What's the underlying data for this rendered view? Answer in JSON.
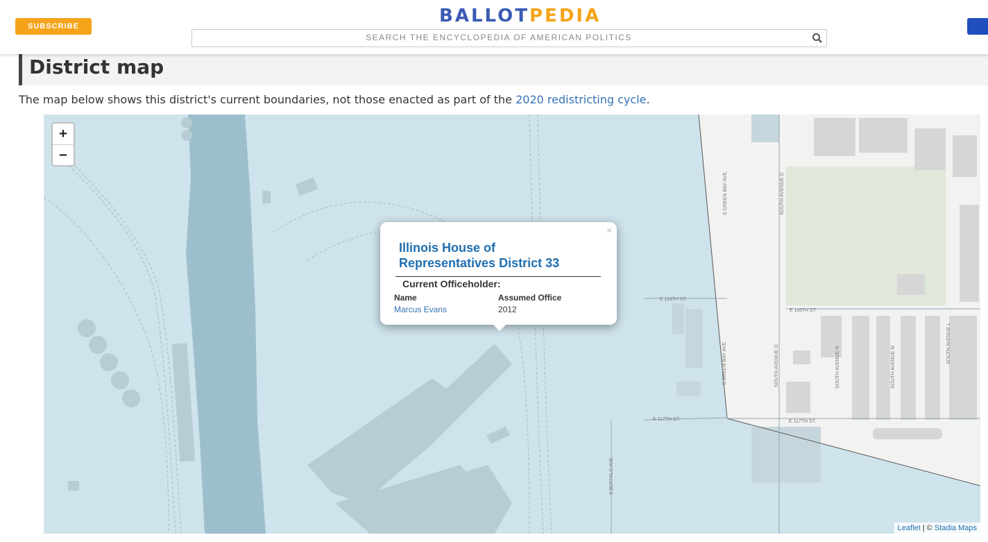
{
  "header": {
    "subscribe_label": "SUBSCRIBE",
    "logo_part1": "BALLOT",
    "logo_part2": "PEDIA",
    "search_placeholder": "SEARCH THE ENCYCLOPEDIA OF AMERICAN POLITICS"
  },
  "section": {
    "title": "District map",
    "description_prefix": "The map below shows this district's current boundaries, not those enacted as part of the",
    "description_link": "2020 redistricting cycle",
    "description_suffix": "."
  },
  "map": {
    "zoom_in": "+",
    "zoom_out": "−",
    "streets": [
      "E 116TH ST.",
      "E 116TH ST.",
      "E 117TH ST.",
      "E 117TH ST.",
      "S GREEN BAY AVE.",
      "S GREEN BAY AVE.",
      "SOUTH AVENUE O",
      "SOUTH AVENUE O",
      "SOUTH AVENUE N",
      "SOUTH AVENUE M",
      "SOUTH AVENUE L",
      "S BUFFALO AVE."
    ],
    "popup": {
      "close": "×",
      "title": "Illinois House of Representatives District 33",
      "current_label": "Current Officeholder:",
      "col_name": "Name",
      "col_assumed": "Assumed Office",
      "officeholder_name": "Marcus Evans",
      "assumed_year": "2012"
    },
    "attribution": {
      "leaflet": "Leaflet",
      "separator": " | © ",
      "provider": "Stadia Maps"
    },
    "colors": {
      "district_fill": "#cfe3ec",
      "river": "#9dbfcc",
      "land": "#f2f2f0",
      "park": "#dfe8da",
      "buildings": "#d4d4d4",
      "link": "#1f6fb0",
      "accent": "#f5a31a"
    }
  }
}
